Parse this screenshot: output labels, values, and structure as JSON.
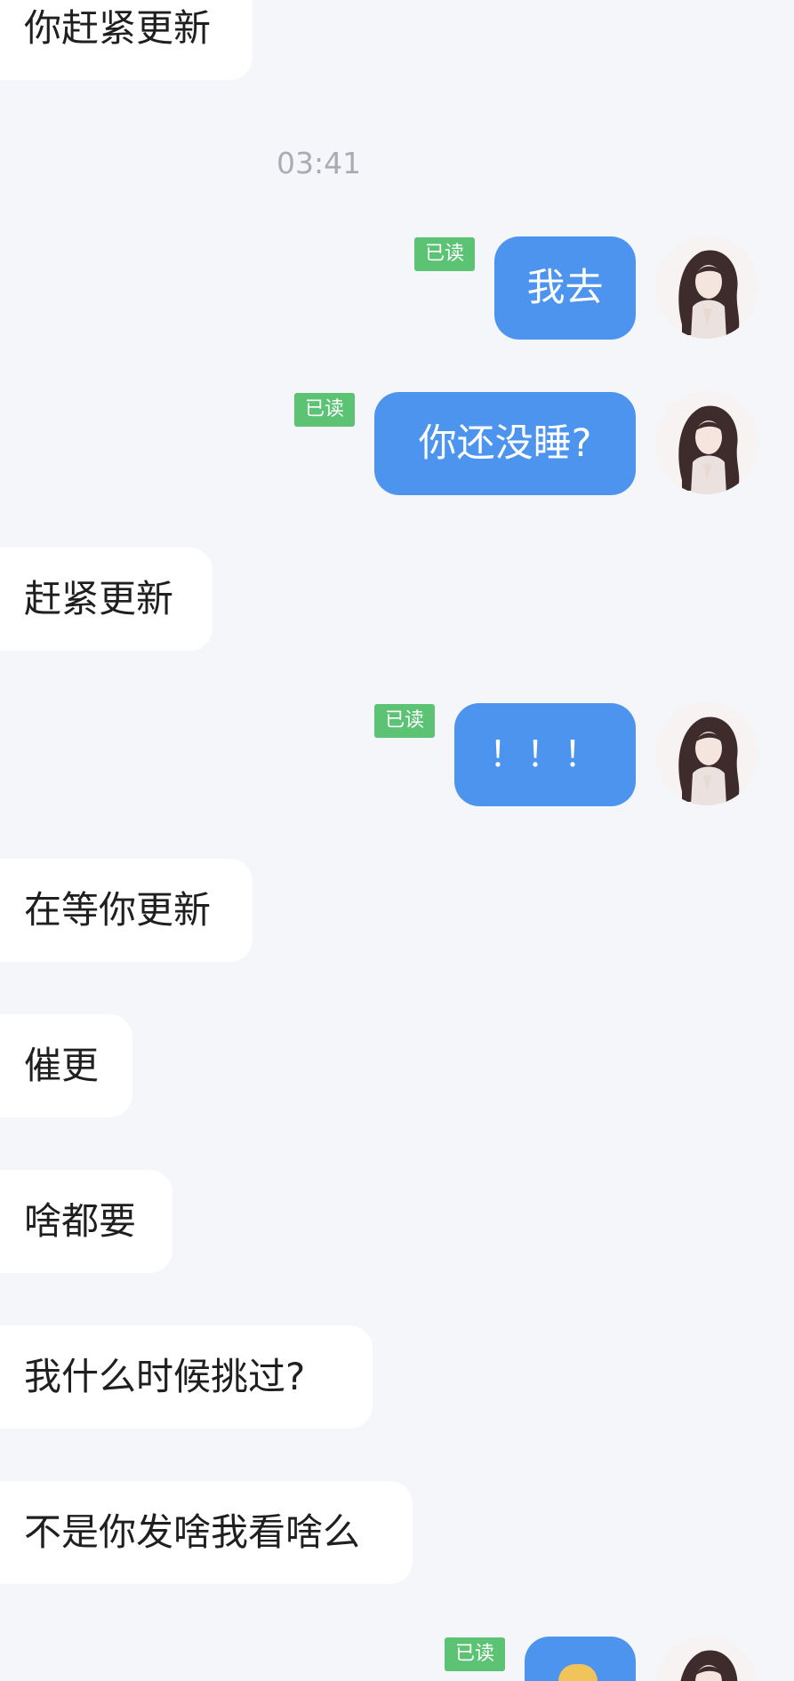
{
  "messages": {
    "m1_text": "你赶紧更新",
    "timestamp": "03:41",
    "m2_text": "我去",
    "m3_text": "你还没睡?",
    "m4_text": "赶紧更新",
    "m5_text": "！！！",
    "m6_text": "在等你更新",
    "m7_text": "催更",
    "m8_text": "啥都要",
    "m9_text": "我什么时候挑过?",
    "m10_text": "不是你发啥我看啥么"
  },
  "read_label": "已读",
  "colors": {
    "background": "#f4f6f9",
    "incoming_bubble": "#ffffff",
    "outgoing_bubble": "#4c94ee",
    "read_badge": "#5cc274",
    "timestamp_text": "#a9acb2"
  },
  "icons": {
    "avatar": "girl-portrait-avatar",
    "last_message": "halo-emoji-sticker"
  }
}
